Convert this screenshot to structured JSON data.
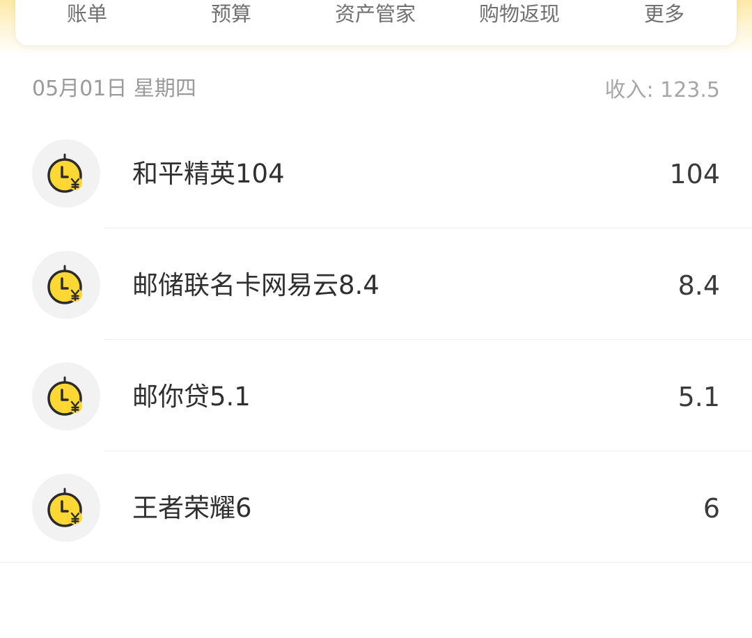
{
  "nav": {
    "items": [
      {
        "label": "账单"
      },
      {
        "label": "预算"
      },
      {
        "label": "资产管家"
      },
      {
        "label": "购物返现"
      },
      {
        "label": "更多"
      }
    ]
  },
  "day": {
    "date": "05月01日 星期四",
    "income_label": "收入:",
    "income_value": "123.5"
  },
  "transactions": [
    {
      "title": "和平精英104",
      "amount": "104",
      "icon": "clock-yuan-icon"
    },
    {
      "title": "邮储联名卡网易云8.4",
      "amount": "8.4",
      "icon": "clock-yuan-icon"
    },
    {
      "title": "邮你贷5.1",
      "amount": "5.1",
      "icon": "clock-yuan-icon"
    },
    {
      "title": "王者荣耀6",
      "amount": "6",
      "icon": "clock-yuan-icon"
    }
  ],
  "colors": {
    "accent": "#fdd835",
    "icon_bg": "#f2f2f2"
  }
}
